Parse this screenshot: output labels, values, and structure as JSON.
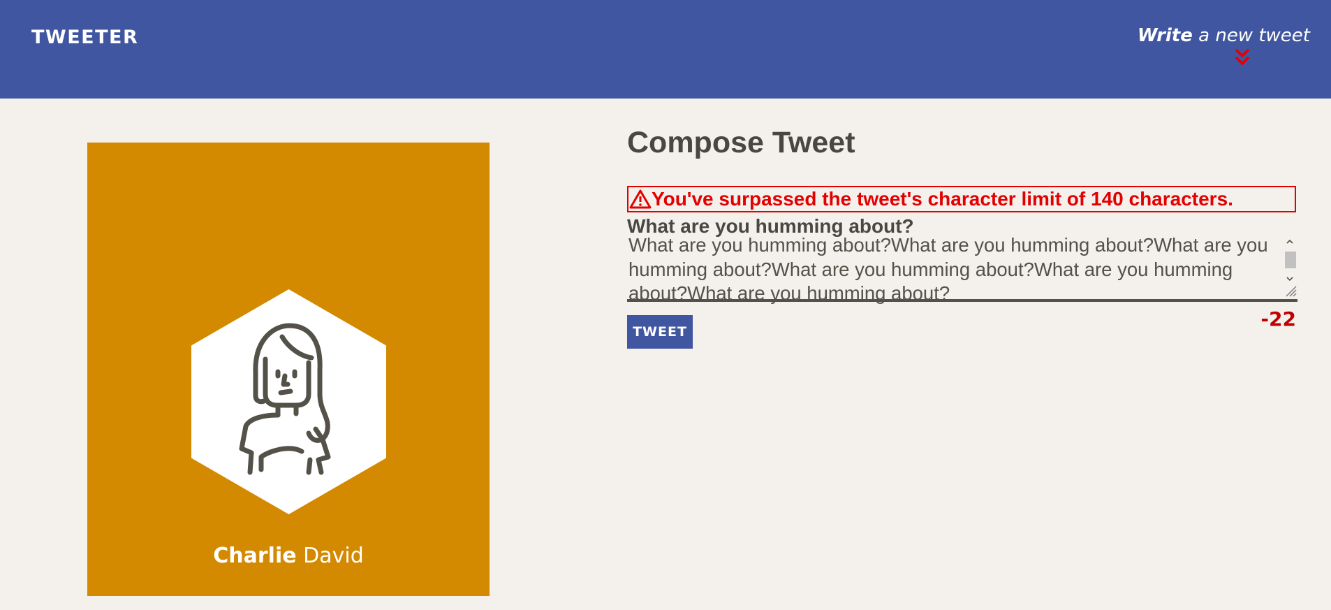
{
  "nav": {
    "brand": "TWEETER",
    "write_strong": "Write",
    "write_rest": " a new tweet",
    "arrow_icon": "double-chevron-down-icon",
    "colors": {
      "background": "#4056a1",
      "arrow": "#e30000"
    }
  },
  "profile": {
    "first_name": "Charlie",
    "last_name": " David",
    "avatar_icon": "user-avatar-icon",
    "colors": {
      "card": "#d38900"
    }
  },
  "compose": {
    "title": "Compose Tweet",
    "error_message": "You've surpassed the tweet's character limit of 140 characters.",
    "error_icon": "warning-icon",
    "label": "What are you humming about?",
    "textarea_value": "What are you humming about?What are you humming about?What are you humming about?What are you humming about?What are you humming about?What are you humming about?",
    "button_label": "TWEET",
    "counter": "-22",
    "colors": {
      "error": "#e30000",
      "counter": "#c00000",
      "button": "#4056a1"
    }
  }
}
